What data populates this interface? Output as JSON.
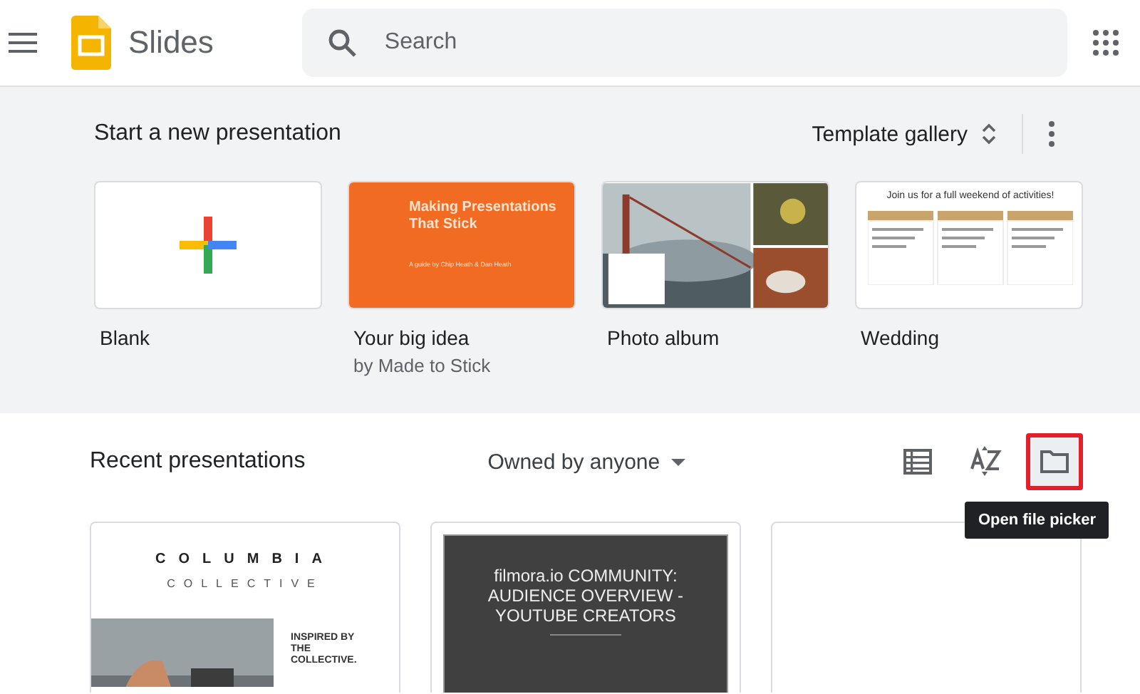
{
  "app": {
    "name": "Slides"
  },
  "search": {
    "placeholder": "Search"
  },
  "templates": {
    "heading": "Start a new presentation",
    "gallery_button": "Template gallery",
    "items": [
      {
        "kind": "blank",
        "label": "Blank"
      },
      {
        "kind": "idea",
        "label": "Your big idea",
        "sublabel": "by Made to Stick",
        "slide_title": "Making Presentations That Stick",
        "slide_subtitle": "A guide by Chip Heath & Dan Heath"
      },
      {
        "label": "Photo album"
      },
      {
        "kind": "wedding",
        "label": "Wedding",
        "slide_title": "Join us for a full weekend of activities!"
      }
    ]
  },
  "recent": {
    "heading": "Recent presentations",
    "owner_filter": "Owned by anyone",
    "tools": [
      {
        "kind": "list",
        "highlighted": false
      },
      {
        "kind": "sort",
        "highlighted": false
      },
      {
        "kind": "folder",
        "highlighted": true
      }
    ],
    "tooltip": "Open file picker",
    "files": [
      {
        "kind": "columbia",
        "title": "COLUMBIA",
        "subtitle": "COLLECTIVE",
        "caption": "INSPIRED BY THE COLLECTIVE."
      },
      {
        "kind": "dark",
        "title": "filmora.io COMMUNITY: AUDIENCE OVERVIEW - YOUTUBE CREATORS"
      },
      {
        "kind": "empty"
      }
    ]
  }
}
